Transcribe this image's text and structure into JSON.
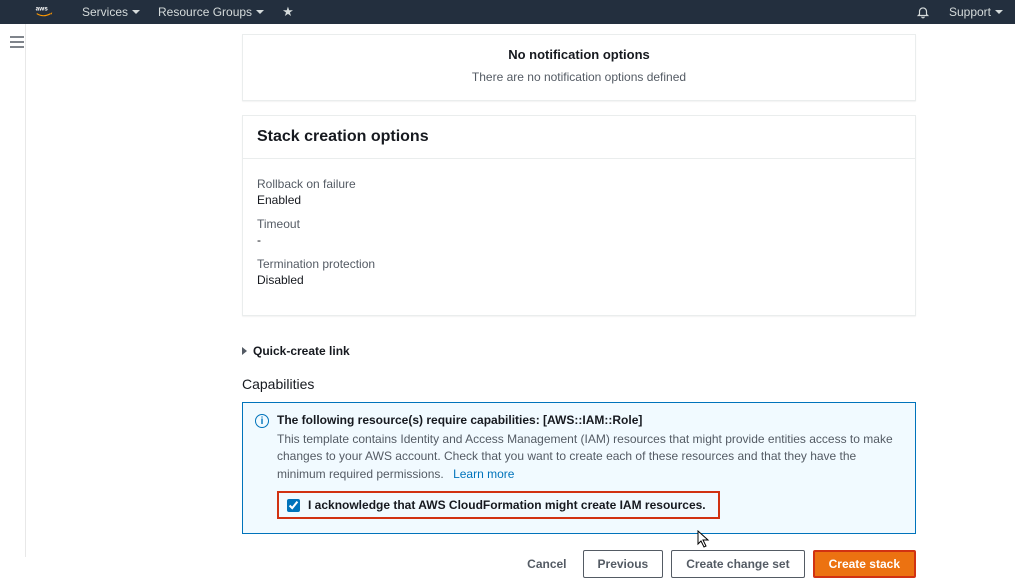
{
  "topnav": {
    "services": "Services",
    "resource_groups": "Resource Groups",
    "support": "Support"
  },
  "notification_panel": {
    "title": "No notification options",
    "subtitle": "There are no notification options defined"
  },
  "stack_options": {
    "header": "Stack creation options",
    "rollback_label": "Rollback on failure",
    "rollback_value": "Enabled",
    "timeout_label": "Timeout",
    "timeout_value": "-",
    "termination_label": "Termination protection",
    "termination_value": "Disabled"
  },
  "quick_create": "Quick-create link",
  "capabilities": {
    "header": "Capabilities",
    "info_title": "The following resource(s) require capabilities: [AWS::IAM::Role]",
    "info_desc": "This template contains Identity and Access Management (IAM) resources that might provide entities access to make changes to your AWS account. Check that you want to create each of these resources and that they have the minimum required permissions.",
    "learn_more": "Learn more",
    "ack_label": "I acknowledge that AWS CloudFormation might create IAM resources."
  },
  "footer": {
    "cancel": "Cancel",
    "previous": "Previous",
    "change_set": "Create change set",
    "create_stack": "Create stack"
  }
}
